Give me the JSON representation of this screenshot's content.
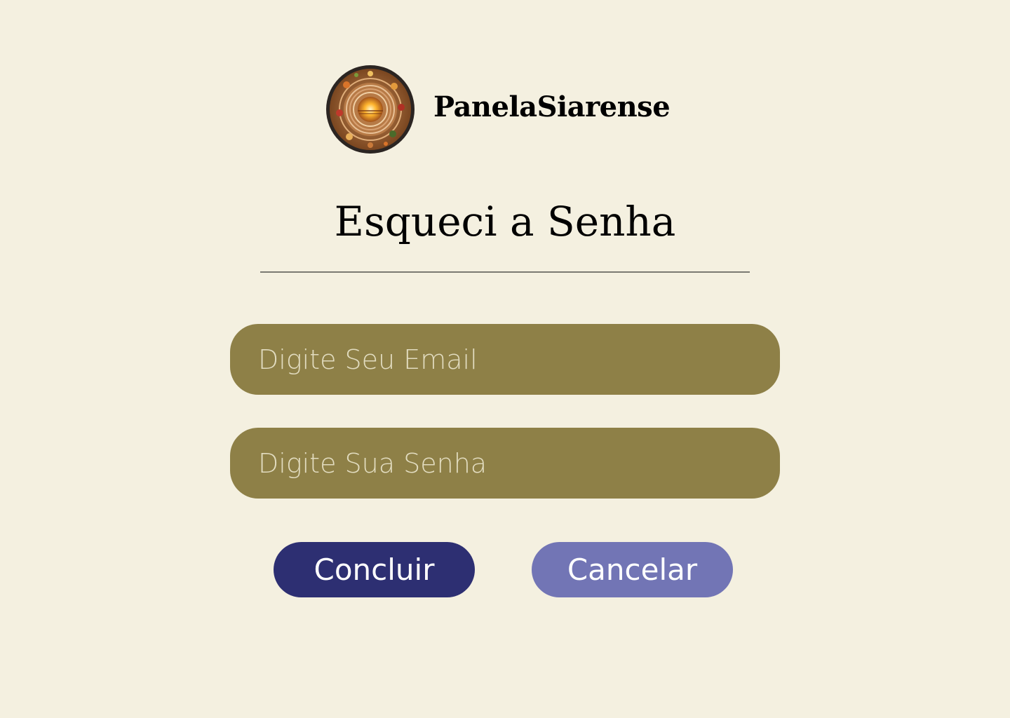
{
  "brand": {
    "name": "PanelaSiarense",
    "logo_icon": "round-food-platter-logo-icon"
  },
  "page": {
    "title": "Esqueci a Senha"
  },
  "form": {
    "email_placeholder": "Digite Seu Email",
    "password_placeholder": "Digite Sua Senha",
    "email_value": "",
    "password_value": ""
  },
  "actions": {
    "confirm_label": "Concluir",
    "cancel_label": "Cancelar"
  },
  "colors": {
    "background": "#f4f0e0",
    "field": "#8e8047",
    "primary_button": "#2d2f72",
    "secondary_button": "#7275b5"
  }
}
